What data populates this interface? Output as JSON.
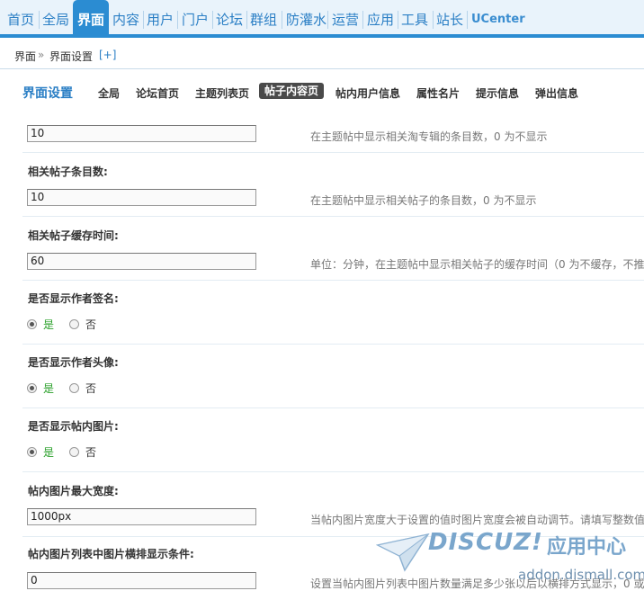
{
  "topnav": {
    "items": [
      "首页",
      "全局",
      "界面",
      "内容",
      "用户",
      "门户",
      "论坛",
      "群组",
      "防灌水",
      "运营",
      "应用",
      "工具",
      "站长",
      "UCenter"
    ],
    "active": "界面"
  },
  "breadcrumb": {
    "root": "界面",
    "sep": "»",
    "current": "界面设置",
    "plus": "[+]"
  },
  "subnav": {
    "title": "界面设置",
    "tabs": [
      "全局",
      "论坛首页",
      "主题列表页",
      "帖子内容页",
      "帖内用户信息",
      "属性名片",
      "提示信息",
      "弹出信息"
    ],
    "active_tab": "帖子内容页"
  },
  "rows": [
    {
      "label": "",
      "value": "10",
      "tip": "在主题帖中显示相关淘专辑的条目数，0 为不显示"
    },
    {
      "label": "相关帖子条目数:",
      "value": "10",
      "tip": "在主题帖中显示相关帖子的条目数，0 为不显示"
    },
    {
      "label": "相关帖子缓存时间:",
      "value": "60",
      "tip": "单位：分钟，在主题帖中显示相关帖子的缓存时间（0 为不缓存，不推"
    },
    {
      "label": "是否显示作者签名:",
      "yes": "是",
      "no": "否"
    },
    {
      "label": "是否显示作者头像:",
      "yes": "是",
      "no": "否"
    },
    {
      "label": "是否显示帖内图片:",
      "yes": "是",
      "no": "否"
    },
    {
      "label": "帖内图片最大宽度:",
      "value": "1000px",
      "tip": "当帖内图片宽度大于设置的值时图片宽度会被自动调节。请填写整数值"
    },
    {
      "label": "帖内图片列表中图片横排显示条件:",
      "value": "0",
      "tip": "设置当帖内图片列表中图片数量满足多少张以后以横排方式显示，0 或"
    }
  ],
  "watermark": {
    "logo": "DISCUZ!",
    "brand": "应用中心",
    "url": "addon.dismall.com"
  }
}
